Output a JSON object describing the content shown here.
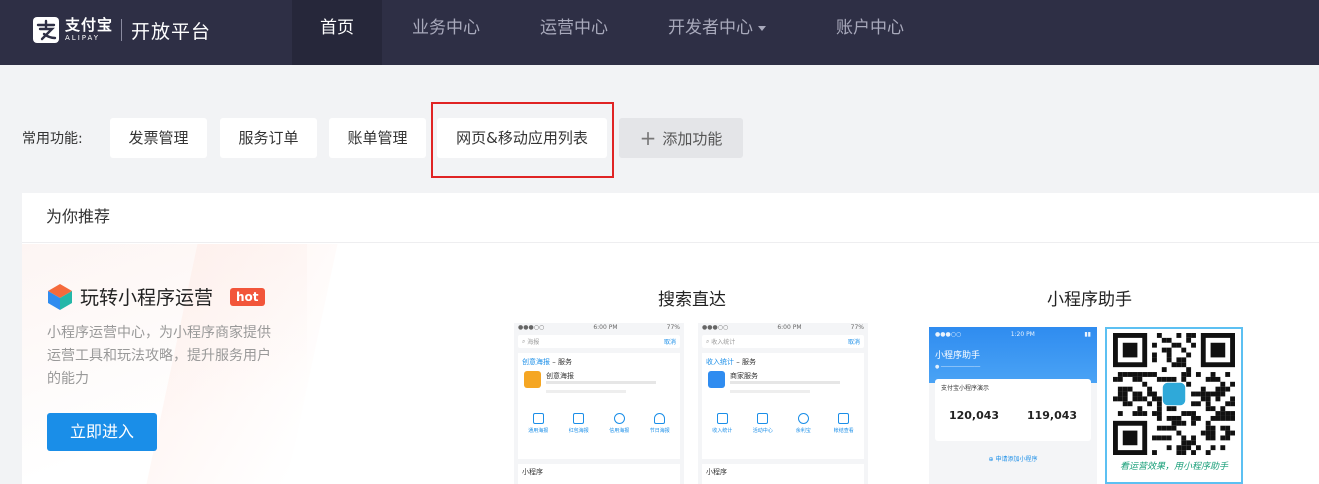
{
  "header": {
    "brand_cn": "支付宝",
    "brand_en": "ALIPAY",
    "platform_title": "开放平台",
    "nav": [
      {
        "label": "首页",
        "active": true
      },
      {
        "label": "业务中心",
        "active": false
      },
      {
        "label": "运营中心",
        "active": false
      },
      {
        "label": "开发者中心",
        "active": false,
        "has_dropdown": true
      },
      {
        "label": "账户中心",
        "active": false
      }
    ]
  },
  "quick": {
    "label": "常用功能:",
    "items": [
      "发票管理",
      "服务订单",
      "账单管理",
      "网页&移动应用列表"
    ],
    "add_label": "添加功能"
  },
  "recommend": {
    "header": "为你推荐",
    "promo": {
      "title": "玩转小程序运营",
      "badge": "hot",
      "desc": "小程序运营中心，为小程序商家提供运营工具和玩法攻略，提升服务用户的能力",
      "button": "立即进入"
    },
    "search_title": "搜索直达",
    "assistant_title": "小程序助手",
    "phone1": {
      "time": "6:00 PM",
      "battery": "77%",
      "search_text": "海报",
      "cancel": "取消",
      "section_title_a": "创意海报",
      "section_title_b": " – 服务",
      "item_name": "创意海报",
      "tags": [
        "通用海报",
        "红包海报",
        "信用海报",
        "节日海报"
      ],
      "footer": "小程序"
    },
    "phone2": {
      "time": "6:00 PM",
      "battery": "77%",
      "search_text": "收入统计",
      "cancel": "取消",
      "section_title_a": "收入统计",
      "section_title_b": " – 服务",
      "item_name": "商家服务",
      "tags": [
        "收入统计",
        "活动中心",
        "余利宝",
        "帐结查看"
      ],
      "footer": "小程序"
    },
    "assistant": {
      "time": "1:20 PM",
      "title": "小程序助手",
      "card_name": "支付宝小程序演示",
      "num1": "120,043",
      "num2": "119,043",
      "add": "申请添加小程序"
    },
    "qr_caption": "看运营效果，用小程序助手"
  },
  "colors": {
    "nav_bg": "#2e2f45",
    "primary": "#1a8ee8",
    "hot": "#f2553a",
    "highlight": "#e02424"
  }
}
